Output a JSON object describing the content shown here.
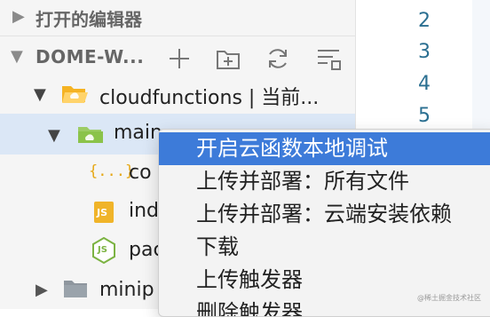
{
  "sidebar": {
    "open_editors_label": "打开的编辑器",
    "workspace": {
      "title": "DOME-W...",
      "tools": [
        "new-file-icon",
        "new-folder-icon",
        "refresh-icon",
        "collapse-all-icon"
      ]
    },
    "tree": [
      {
        "label": "cloudfunctions | 当前...",
        "icon": "cloud-folder-open-icon"
      },
      {
        "label": "main",
        "icon": "cloud-folder-icon",
        "selected": true
      },
      {
        "label": "co",
        "icon": "json-file-icon",
        "icon_text": "{...}"
      },
      {
        "label": "ind",
        "icon": "js-file-icon",
        "icon_text": "JS"
      },
      {
        "label": "pac",
        "icon": "node-file-icon",
        "icon_text": "JS"
      },
      {
        "label": "minip",
        "icon": "folder-icon"
      }
    ]
  },
  "editor": {
    "line_numbers": [
      "2",
      "3",
      "4",
      "5"
    ]
  },
  "context_menu": {
    "items": [
      {
        "label": "开启云函数本地调试",
        "active": true
      },
      {
        "label": "上传并部署：所有文件"
      },
      {
        "label": "上传并部署：云端安装依赖"
      },
      {
        "label": "下载"
      },
      {
        "label": "上传触发器"
      },
      {
        "label": "删除触发器"
      }
    ]
  },
  "watermark": "@稀土掘金技术社区",
  "colors": {
    "accent": "#3d7bd9",
    "folder": "#f5b323",
    "cloud_folder": "#8bc34a",
    "node_green": "#7cb342"
  }
}
